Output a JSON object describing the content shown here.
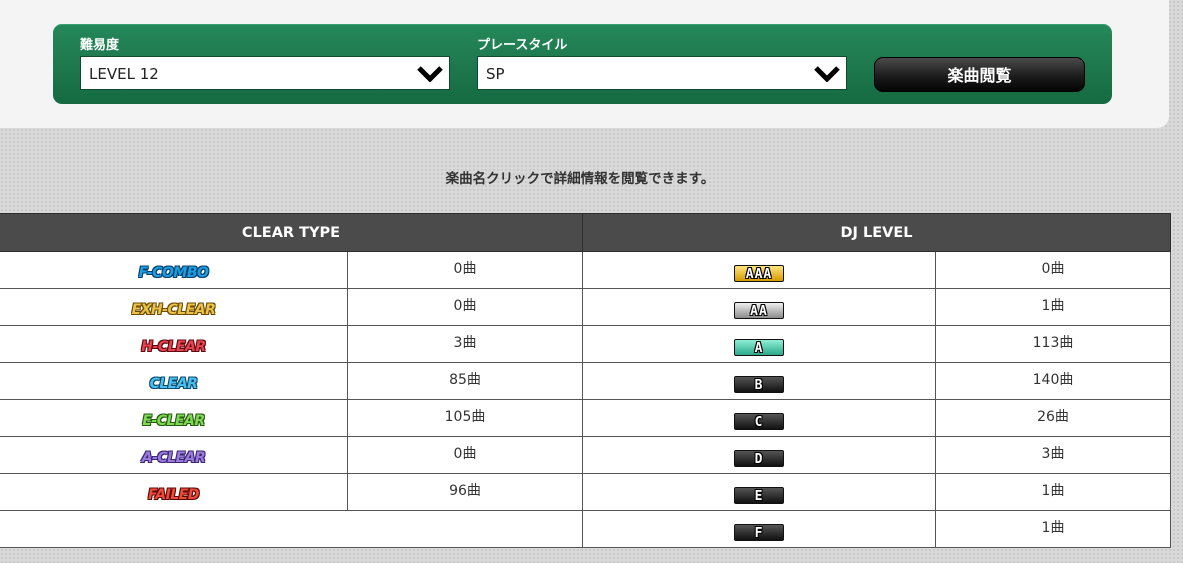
{
  "filters": {
    "difficulty": {
      "label": "難易度",
      "value": "LEVEL 12"
    },
    "play_style": {
      "label": "プレースタイル",
      "value": "SP"
    },
    "browse_button": "楽曲閲覧"
  },
  "notice": "楽曲名クリックで詳細情報を閲覧できます。",
  "table": {
    "clear_type_header": "CLEAR TYPE",
    "dj_level_header": "DJ LEVEL",
    "rows": [
      {
        "clear_type": "F-COMBO",
        "clear_color": "#1aa0e0",
        "clear_stroke": "#0a3d6b",
        "clear_count": "0曲",
        "dj_level": "AAA",
        "dj_bg": "linear-gradient(#ffe680,#d49a00)",
        "dj_count": "0曲"
      },
      {
        "clear_type": "EXH-CLEAR",
        "clear_color": "#e8c24a",
        "clear_stroke": "#6b4a00",
        "clear_count": "0曲",
        "dj_level": "AA",
        "dj_bg": "linear-gradient(#f0f0f0,#8a8a8a)",
        "dj_count": "1曲"
      },
      {
        "clear_type": "H-CLEAR",
        "clear_color": "#e8434f",
        "clear_stroke": "#5a0a10",
        "clear_count": "3曲",
        "dj_level": "A",
        "dj_bg": "linear-gradient(#8ff0d6,#2aa88a)",
        "dj_count": "113曲"
      },
      {
        "clear_type": "CLEAR",
        "clear_color": "#4ec0f0",
        "clear_stroke": "#0b4b6b",
        "clear_count": "85曲",
        "dj_level": "B",
        "dj_bg": "linear-gradient(#555,#111)",
        "dj_count": "140曲"
      },
      {
        "clear_type": "E-CLEAR",
        "clear_color": "#7ed957",
        "clear_stroke": "#285a10",
        "clear_count": "105曲",
        "dj_level": "C",
        "dj_bg": "linear-gradient(#555,#111)",
        "dj_count": "26曲"
      },
      {
        "clear_type": "A-CLEAR",
        "clear_color": "#9b7be0",
        "clear_stroke": "#3a2870",
        "clear_count": "0曲",
        "dj_level": "D",
        "dj_bg": "linear-gradient(#555,#111)",
        "dj_count": "3曲"
      },
      {
        "clear_type": "FAILED",
        "clear_color": "#f04a3a",
        "clear_stroke": "#5a0a05",
        "clear_count": "96曲",
        "dj_level": "E",
        "dj_bg": "linear-gradient(#555,#111)",
        "dj_count": "1曲"
      },
      {
        "dj_level": "F",
        "dj_bg": "linear-gradient(#555,#111)",
        "dj_count": "1曲"
      }
    ]
  }
}
